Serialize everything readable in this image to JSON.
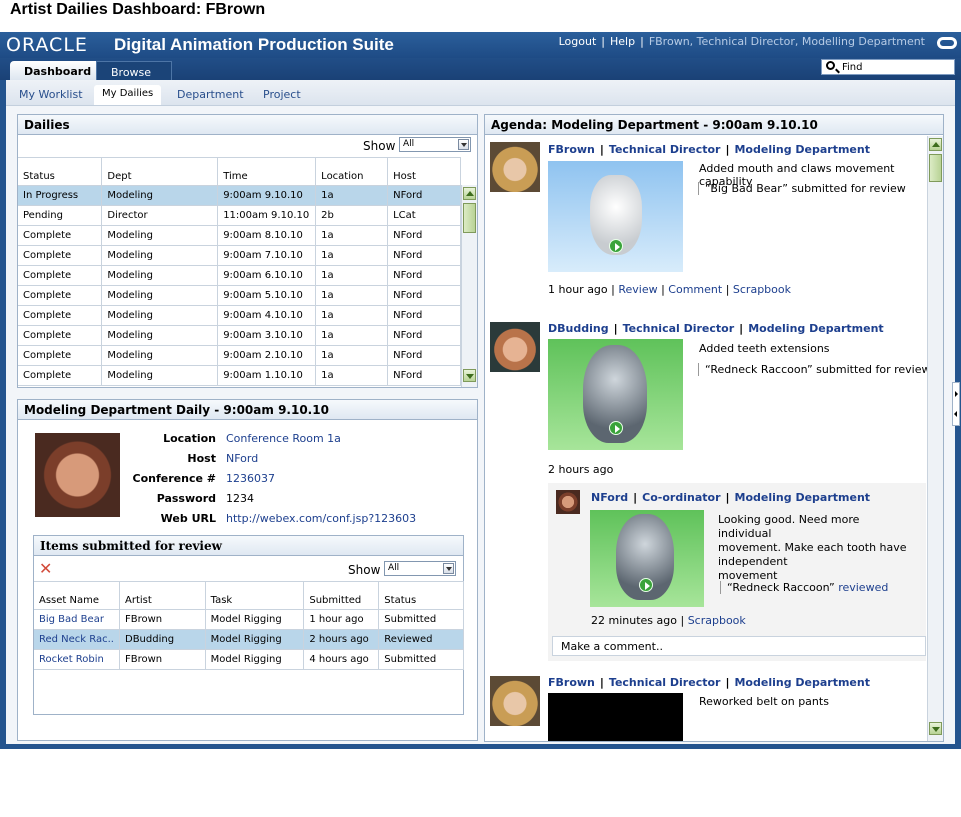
{
  "page_title": "Artist Dailies Dashboard: FBrown",
  "brand": {
    "logo": "ORACLE",
    "suite": "Digital Animation Production Suite"
  },
  "global_links": {
    "logout": "Logout",
    "help": "Help",
    "user": "FBrown, Technical Director, Modelling Department"
  },
  "main_tabs": [
    {
      "label": "Dashboard"
    },
    {
      "label": "Browse"
    }
  ],
  "find": {
    "placeholder": "Find"
  },
  "sub_tabs": [
    {
      "label": "My Worklist"
    },
    {
      "label": "My Dailies"
    },
    {
      "label": "Department"
    },
    {
      "label": "Project"
    }
  ],
  "dailies": {
    "title": "Dailies",
    "show_label": "Show",
    "show_value": "All",
    "columns": [
      "Status",
      "Dept",
      "Time",
      "Location",
      "Host"
    ],
    "rows": [
      [
        "In Progress",
        "Modeling",
        "9:00am  9.10.10",
        "1a",
        "NFord"
      ],
      [
        "Pending",
        "Director",
        "11:00am 9.10.10",
        "2b",
        "LCat"
      ],
      [
        "Complete",
        "Modeling",
        "9:00am  8.10.10",
        "1a",
        "NFord"
      ],
      [
        "Complete",
        "Modeling",
        "9:00am  7.10.10",
        "1a",
        "NFord"
      ],
      [
        "Complete",
        "Modeling",
        "9:00am  6.10.10",
        "1a",
        "NFord"
      ],
      [
        "Complete",
        "Modeling",
        "9:00am  5.10.10",
        "1a",
        "NFord"
      ],
      [
        "Complete",
        "Modeling",
        "9:00am  4.10.10",
        "1a",
        "NFord"
      ],
      [
        "Complete",
        "Modeling",
        "9:00am 3.10.10",
        "1a",
        "NFord"
      ],
      [
        "Complete",
        "Modeling",
        "9:00am  2.10.10",
        "1a",
        "NFord"
      ],
      [
        "Complete",
        "Modeling",
        "9:00am  1.10.10",
        "1a",
        "NFord"
      ]
    ]
  },
  "daily_detail": {
    "title": "Modeling Department Daily - 9:00am 9.10.10",
    "location_label": "Location",
    "location": "Conference Room 1a",
    "host_label": "Host",
    "host": "NFord",
    "conference_label": "Conference #",
    "conference": "1236037",
    "password_label": "Password",
    "password": "1234",
    "weburl_label": "Web URL",
    "weburl": "http://webex.com/conf.jsp?123603"
  },
  "review_items": {
    "title": "Items submitted for review",
    "show_label": "Show",
    "show_value": "All",
    "columns": [
      "Asset Name",
      "Artist",
      "Task",
      "Submitted",
      "Status"
    ],
    "rows": [
      [
        "Big Bad Bear",
        "FBrown",
        "Model Rigging",
        "1 hour ago",
        "Submitted"
      ],
      [
        "Red Neck Rac..",
        "DBudding",
        "Model Rigging",
        "2 hours ago",
        "Reviewed"
      ],
      [
        "Rocket Robin",
        "FBrown",
        "Model Rigging",
        "4 hours ago",
        "Submitted"
      ]
    ]
  },
  "agenda": {
    "title": "Agenda: Modeling Department - 9:00am  9.10.10",
    "posts": [
      {
        "name": "FBrown",
        "role": "Technical Director",
        "dept": "Modeling Department",
        "text": "Added mouth and claws movement capability",
        "quote": "“Big Bad Bear” submitted for review",
        "time": "1 hour ago",
        "links": [
          "Review",
          "Comment",
          "Scrapbook"
        ]
      },
      {
        "name": "DBudding",
        "role": "Technical Director",
        "dept": "Modeling Department",
        "text": "Added teeth extensions",
        "quote": "“Redneck Raccoon” submitted for review",
        "time": "2 hours ago"
      },
      {
        "name": "NFord",
        "role": "Co-ordinator",
        "dept": "Modeling Department",
        "text": "Looking good. Need more individual movement. Make each tooth have independent movement",
        "text_lines": [
          "Looking good. Need more individual",
          "movement. Make each tooth have",
          "independent",
          "movement"
        ],
        "quote": "“Redneck Raccoon”",
        "quote_link": "reviewed",
        "time": "22 minutes ago",
        "links": [
          "Scrapbook"
        ],
        "comment_placeholder": "Make a comment.."
      },
      {
        "name": "FBrown",
        "role": "Technical Director",
        "dept": "Modeling Department",
        "text": "Reworked belt on pants"
      }
    ]
  }
}
